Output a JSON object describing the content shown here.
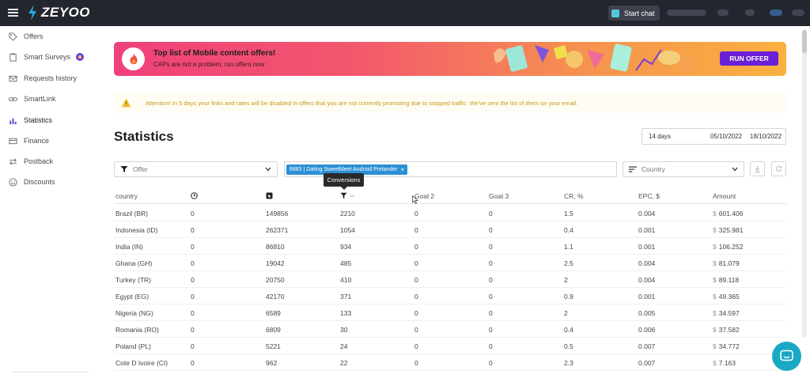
{
  "app": {
    "logo_text": "ZEYOO",
    "start_chat_label": "Start chat"
  },
  "sidebar": {
    "items": [
      {
        "label": "Offers",
        "icon": "tag-icon"
      },
      {
        "label": "Smart Surveys",
        "icon": "clipboard-icon",
        "badge": true
      },
      {
        "label": "Requests history",
        "icon": "mail-icon"
      },
      {
        "label": "SmartLink",
        "icon": "link-icon"
      },
      {
        "label": "Statistics",
        "icon": "bar-chart-icon",
        "active": true
      },
      {
        "label": "Finance",
        "icon": "card-icon"
      },
      {
        "label": "Postback",
        "icon": "arrows-icon"
      },
      {
        "label": "Discounts",
        "icon": "smile-icon"
      }
    ]
  },
  "banner": {
    "title": "Top list of Mobile content offers!",
    "subtitle": "CAPs are not a problem: run offers now",
    "button": "RUN OFFER"
  },
  "alert": {
    "text": "Attention! In 5 days your links and rates will be disabled in offers that you are not currently promoting due to stopped traffic. We've sent the list of them on your email."
  },
  "page": {
    "title": "Statistics"
  },
  "dates": {
    "range": "14 days",
    "from": "05/10/2022",
    "to": "18/10/2022"
  },
  "filters": {
    "offer_placeholder": "Offer",
    "chip": "6883 | Dating SweetMeet Android Prelander",
    "chip_close": "×",
    "country_placeholder": "Country"
  },
  "tooltip": "Conversions",
  "table": {
    "headers": {
      "country": "country",
      "goal2": "Goal 2",
      "goal3": "Goal 3",
      "cr": "CR, %",
      "epc": "EPC, $",
      "amount": "Amount"
    },
    "currency": "$",
    "rows": [
      {
        "country": "Brazil (BR)",
        "time": "0",
        "clicks": "149856",
        "conv": "2210",
        "goal2": "0",
        "goal3": "0",
        "cr": "1.5",
        "epc": "0.004",
        "amount": "601.406"
      },
      {
        "country": "Indonesia (ID)",
        "time": "0",
        "clicks": "262371",
        "conv": "1054",
        "goal2": "0",
        "goal3": "0",
        "cr": "0.4",
        "epc": "0.001",
        "amount": "325.981"
      },
      {
        "country": "India (IN)",
        "time": "0",
        "clicks": "86810",
        "conv": "934",
        "goal2": "0",
        "goal3": "0",
        "cr": "1.1",
        "epc": "0.001",
        "amount": "106.252"
      },
      {
        "country": "Ghana (GH)",
        "time": "0",
        "clicks": "19042",
        "conv": "485",
        "goal2": "0",
        "goal3": "0",
        "cr": "2.5",
        "epc": "0.004",
        "amount": "81.079"
      },
      {
        "country": "Turkey (TR)",
        "time": "0",
        "clicks": "20750",
        "conv": "410",
        "goal2": "0",
        "goal3": "0",
        "cr": "2",
        "epc": "0.004",
        "amount": "89.118"
      },
      {
        "country": "Egypt (EG)",
        "time": "0",
        "clicks": "42170",
        "conv": "371",
        "goal2": "0",
        "goal3": "0",
        "cr": "0.9",
        "epc": "0.001",
        "amount": "49.365"
      },
      {
        "country": "Nigeria (NG)",
        "time": "0",
        "clicks": "6589",
        "conv": "133",
        "goal2": "0",
        "goal3": "0",
        "cr": "2",
        "epc": "0.005",
        "amount": "34.597"
      },
      {
        "country": "Romania (RO)",
        "time": "0",
        "clicks": "6809",
        "conv": "30",
        "goal2": "0",
        "goal3": "0",
        "cr": "0.4",
        "epc": "0.006",
        "amount": "37.582"
      },
      {
        "country": "Poland (PL)",
        "time": "0",
        "clicks": "5221",
        "conv": "24",
        "goal2": "0",
        "goal3": "0",
        "cr": "0.5",
        "epc": "0.007",
        "amount": "34.772"
      },
      {
        "country": "Cote D Ivoire (CI)",
        "time": "0",
        "clicks": "962",
        "conv": "22",
        "goal2": "0",
        "goal3": "0",
        "cr": "2.3",
        "epc": "0.007",
        "amount": "7.163"
      }
    ]
  },
  "colors": {
    "topbar": "#23252f",
    "accent": "#2b8fd6",
    "run_offer": "#6b1fd6",
    "chat": "#19a9c4"
  }
}
